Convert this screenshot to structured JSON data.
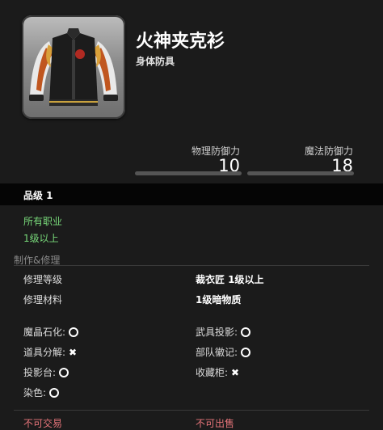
{
  "item": {
    "name": "火神夹克衫",
    "category": "身体防具",
    "icon": "jacket-icon"
  },
  "stats": {
    "physical_label": "物理防御力",
    "physical_value": "10",
    "magic_label": "魔法防御力",
    "magic_value": "18"
  },
  "grade": "品级 1",
  "requirements": {
    "jobs": "所有职业",
    "level": "1级以上"
  },
  "crafting": {
    "title": "制作&修理",
    "repair_level_label": "修理等级",
    "repair_level_value": "裁衣匠 1级以上",
    "repair_material_label": "修理材料",
    "repair_material_value": "1级暗物质"
  },
  "properties": [
    {
      "label": "魔晶石化:",
      "available": true
    },
    {
      "label": "武具投影:",
      "available": true
    },
    {
      "label": "道具分解:",
      "available": false
    },
    {
      "label": "部队徽记:",
      "available": true
    },
    {
      "label": "投影台:",
      "available": true
    },
    {
      "label": "收藏柜:",
      "available": false
    },
    {
      "label": "染色:",
      "available": true
    }
  ],
  "restrictions": {
    "trade": "不可交易",
    "sell": "不可出售"
  },
  "colors": {
    "background": "#1b1b1b",
    "green_text": "#78d97a",
    "red_text": "#e7757a"
  }
}
